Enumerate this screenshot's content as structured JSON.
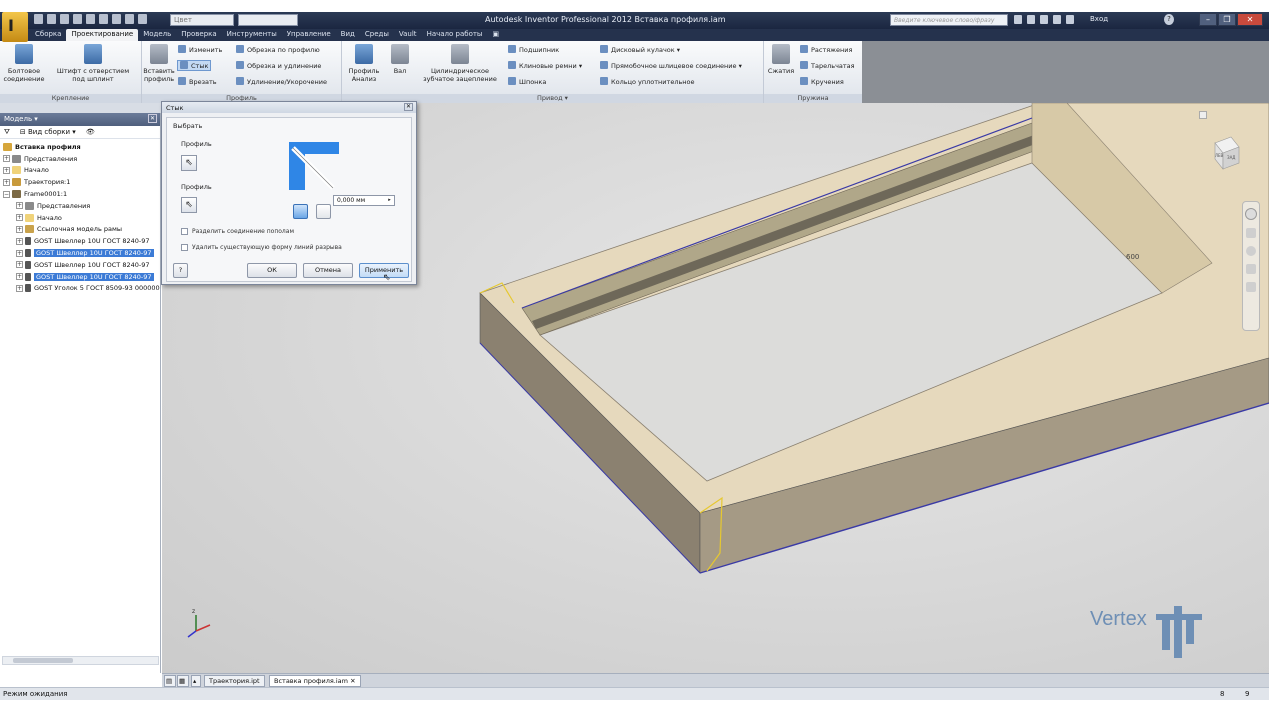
{
  "app": {
    "title": "Autodesk Inventor Professional 2012   Вставка профиля.iam",
    "app_button_letter": "I",
    "qat_combo1": "Цвет",
    "help_search_placeholder": "Введите ключевое слово/фразу",
    "login": "Вход"
  },
  "tabs": [
    {
      "label": "Сборка"
    },
    {
      "label": "Проектирование"
    },
    {
      "label": "Модель"
    },
    {
      "label": "Проверка"
    },
    {
      "label": "Инструменты"
    },
    {
      "label": "Управление"
    },
    {
      "label": "Вид"
    },
    {
      "label": "Среды"
    },
    {
      "label": "Vault"
    },
    {
      "label": "Начало работы"
    }
  ],
  "ribbon": {
    "fastening": {
      "title": "Крепление",
      "bolted": "Болтовое соединение",
      "pin": "Штифт с отверстием под шплинт"
    },
    "frame": {
      "title": "Профиль",
      "insert": "Вставить профиль",
      "change": "Изменить",
      "joint": "Стык",
      "notch": "Врезать",
      "trim_profile": "Обрезка по профилю",
      "trim_extend": "Обрезка и удлинение",
      "lengthen": "Удлинение/Укорочение"
    },
    "drive": {
      "title": "Привод",
      "profile_analysis": "Профиль Анализ",
      "shaft": "Вал",
      "spur_gear": "Цилиндрическое зубчатое зацепление",
      "bearing": "Подшипник",
      "vbelts": "Клиновые ремни",
      "key": "Шпонка",
      "disc_cam": "Дисковый кулачок",
      "spline": "Прямобочное шлицевое соединение",
      "oring": "Кольцо уплотнительное"
    },
    "spring": {
      "title": "Пружина",
      "compression": "Сжатия",
      "extension": "Растяжения",
      "belleville": "Тарельчатая",
      "torsion": "Кручения"
    }
  },
  "browser": {
    "header": "Модель",
    "view_label": "Вид сборки",
    "items": [
      {
        "label": "Вставка профиля",
        "selected": false,
        "bold": true
      },
      {
        "label": "Представления",
        "selected": false
      },
      {
        "label": "Начало",
        "selected": false
      },
      {
        "label": "Траектория:1",
        "selected": false
      },
      {
        "label": "Frame0001:1",
        "selected": false
      },
      {
        "label": "Представления",
        "selected": false
      },
      {
        "label": "Начало",
        "selected": false
      },
      {
        "label": "Ссылочная модель рамы",
        "selected": false
      },
      {
        "label": "GOST Швеллер 10U ГОСТ 8240-97",
        "selected": false
      },
      {
        "label": "GOST Швеллер 10U ГОСТ 8240-97",
        "selected": true
      },
      {
        "label": "GOST Швеллер 10U ГОСТ 8240-97",
        "selected": false
      },
      {
        "label": "GOST Швеллер 10U ГОСТ 8240-97",
        "selected": true
      },
      {
        "label": "GOST Уголок 5 ГОСТ 8509-93 000000",
        "selected": false
      }
    ]
  },
  "dialog": {
    "title": "Стык",
    "group": "Выбрать",
    "profile1_label": "Профиль",
    "profile2_label": "Профиль",
    "gap_value": "0,000 мм",
    "split_evenly": "Разделить соединение пополам",
    "remove_cut": "Удалить существующую форму линий разрыва",
    "ok": "ОК",
    "cancel": "Отмена",
    "apply": "Применить"
  },
  "viewcube": {
    "labels": [
      "ЛЕВ",
      "ЗАД"
    ]
  },
  "doc_tabs": [
    {
      "label": "Траектория.ipt",
      "active": false
    },
    {
      "label": "Вставка профиля.iam",
      "active": true
    }
  ],
  "status": {
    "text": "Режим ожидания",
    "num1": "8",
    "num2": "9"
  },
  "watermark": "Vertex"
}
